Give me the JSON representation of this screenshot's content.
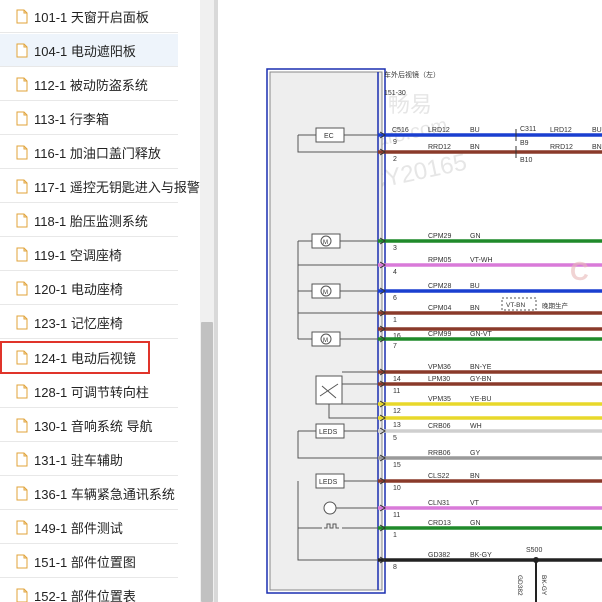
{
  "sidebar": {
    "items": [
      {
        "label": "101-1 天窗开启面板"
      },
      {
        "label": "104-1 电动遮阳板"
      },
      {
        "label": "112-1 被动防盗系统"
      },
      {
        "label": "113-1 行李箱"
      },
      {
        "label": "116-1 加油口盖门释放"
      },
      {
        "label": "117-1 遥控无钥匙进入与报警"
      },
      {
        "label": "118-1 胎压监测系统"
      },
      {
        "label": "119-1 空调座椅"
      },
      {
        "label": "120-1 电动座椅"
      },
      {
        "label": "123-1 记忆座椅"
      },
      {
        "label": "124-1 电动后视镜"
      },
      {
        "label": "128-1 可调节转向柱"
      },
      {
        "label": "130-1 音响系统 导航"
      },
      {
        "label": "131-1 驻车辅助"
      },
      {
        "label": "136-1 车辆紧急通讯系统"
      },
      {
        "label": "149-1 部件测试"
      },
      {
        "label": "151-1 部件位置图"
      },
      {
        "label": "152-1 部件位置表"
      }
    ],
    "selected_label": "104-1 电动遮阳板",
    "boxed_label": "124-1 电动后视镜"
  },
  "diagram": {
    "title": "车外后视镜（左）",
    "page_ref": "151-30",
    "connector_left": "C516",
    "connector_right": "C311",
    "ec_label": "EC",
    "leds_label": "LEDS",
    "splice_label": "S500",
    "late_production_note": "晚期生产",
    "watermark_lines": [
      "畅易",
      "car8.com",
      "CY20165"
    ],
    "wires": [
      {
        "pin": "9",
        "circuit": "LRD12",
        "color_code": "BU",
        "right_pin": "B9",
        "right_circuit": "LRD12",
        "right_color_code": "BU",
        "color": "#1a3fd0"
      },
      {
        "pin": "2",
        "circuit": "RRD12",
        "color_code": "BN",
        "right_pin": "B10",
        "right_circuit": "RRD12",
        "right_color_code": "BN",
        "color": "#8a3a2a"
      },
      {
        "pin": "3",
        "circuit": "CPM29",
        "color_code": "GN",
        "color": "#1f8a2a"
      },
      {
        "pin": "4",
        "circuit": "RPM05",
        "color_code": "VT-WH",
        "color": "#d97ad9"
      },
      {
        "pin": "6",
        "circuit": "CPM28",
        "color_code": "BU",
        "color": "#1a3fd0"
      },
      {
        "pin": "1",
        "circuit": "CPM04",
        "color_code": "BN",
        "alt_color_code": "VT-BN",
        "color": "#8a3a2a"
      },
      {
        "pin": "16",
        "circuit": "",
        "color_code": "",
        "color": "#8a3a2a"
      },
      {
        "pin": "7",
        "circuit": "CPM99",
        "color_code": "GN-VT",
        "color": "#1f8a2a"
      },
      {
        "pin": "14",
        "circuit": "VPM36",
        "color_code": "BN-YE",
        "color": "#8a3a2a"
      },
      {
        "pin": "11",
        "circuit": "LPM30",
        "color_code": "GY-BN",
        "color": "#8a3a2a"
      },
      {
        "pin": "12",
        "circuit": "VPM35",
        "color_code": "YE-BU",
        "color": "#e8d82a"
      },
      {
        "pin": "13",
        "circuit": "",
        "color_code": "",
        "color": "#e8d82a"
      },
      {
        "pin": "5",
        "circuit": "CRB06",
        "color_code": "WH",
        "color": "#cfcfcf"
      },
      {
        "pin": "15",
        "circuit": "RRB06",
        "color_code": "GY",
        "color": "#9a9a9a"
      },
      {
        "pin": "10",
        "circuit": "CLS22",
        "color_code": "BN",
        "color": "#8a3a2a"
      },
      {
        "pin": "11",
        "circuit": "CLN31",
        "color_code": "VT",
        "color": "#d97ad9"
      },
      {
        "pin": "1",
        "circuit": "CRD13",
        "color_code": "GN",
        "color": "#1f8a2a"
      },
      {
        "pin": "8",
        "circuit": "GD382",
        "color_code": "BK-GY",
        "color": "#222222"
      }
    ],
    "ground_labels": [
      "GD382",
      "BK-GY"
    ]
  }
}
